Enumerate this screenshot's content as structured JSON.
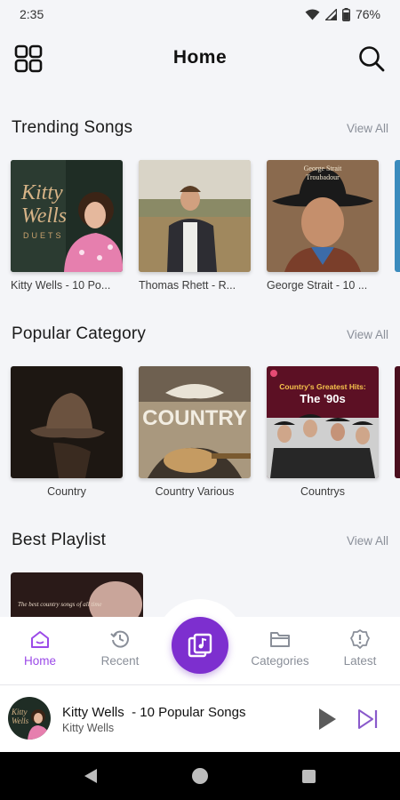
{
  "status_bar": {
    "time": "2:35",
    "battery": "76%"
  },
  "header": {
    "title": "Home",
    "menu_icon": "grid-icon",
    "search_icon": "search-icon"
  },
  "trending": {
    "title": "Trending Songs",
    "view_all": "View All",
    "items": [
      {
        "caption": "Kitty Wells  - 10 Po...",
        "cover_text": "Kitty Wells",
        "cover_sub": "DUETS"
      },
      {
        "caption": "Thomas Rhett - R..."
      },
      {
        "caption": "George Strait - 10 ...",
        "cover_text": "George Strait",
        "cover_sub": "Troubadour"
      }
    ]
  },
  "popular_category": {
    "title": "Popular Category",
    "view_all": "View All",
    "items": [
      {
        "caption": "Country"
      },
      {
        "caption": "Country Various",
        "cover_text": "COUNTRY"
      },
      {
        "caption": "Countrys",
        "cover_text": "Country's Greatest Hits:",
        "cover_sub": "The '90s"
      }
    ]
  },
  "best_playlist": {
    "title": "Best Playlist",
    "view_all": "View All",
    "cover_text": "The best country songs of all time"
  },
  "bottom_nav": {
    "home": "Home",
    "recent": "Recent",
    "categories": "Categories",
    "latest": "Latest"
  },
  "mini_player": {
    "title": "Kitty Wells  - 10 Popular Songs",
    "artist": "Kitty Wells"
  },
  "colors": {
    "accent": "#7d2fcf",
    "active_tab": "#9b4ae8",
    "muted": "#8a8f99"
  }
}
